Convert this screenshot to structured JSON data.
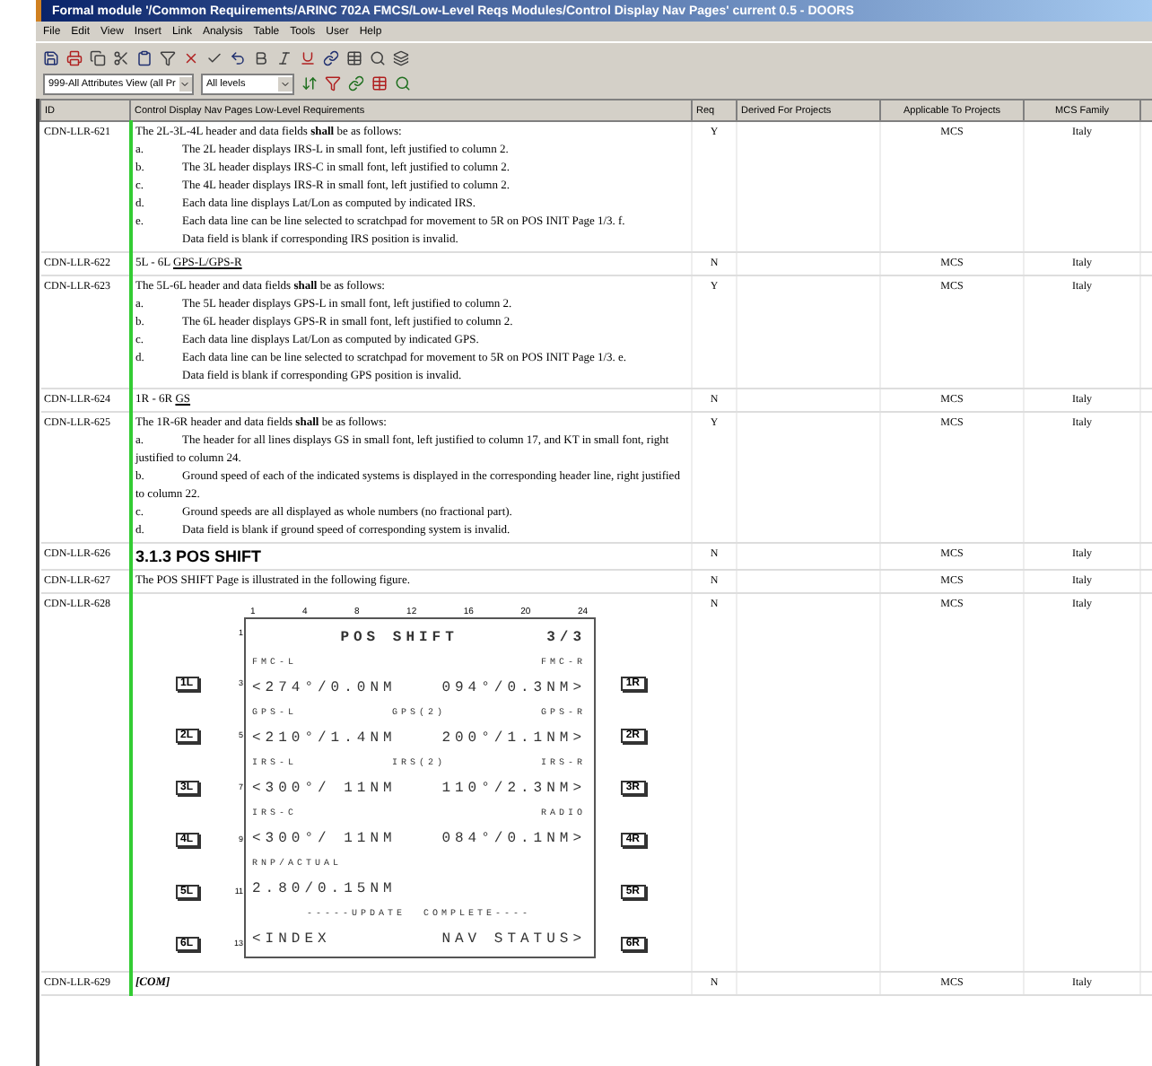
{
  "window": {
    "title": "Formal module '/Common Requirements/ARINC 702A FMCS/Low-Level Reqs Modules/Control Display Nav Pages' current 0.5 - DOORS"
  },
  "menu": [
    "File",
    "Edit",
    "View",
    "Insert",
    "Link",
    "Analysis",
    "Table",
    "Tools",
    "User",
    "Help"
  ],
  "view_bar": {
    "view": "999-All Attributes View (all Pr",
    "levels": "All levels"
  },
  "table": {
    "columns": [
      "ID",
      "Control Display Nav Pages Low-Level Requirements",
      "Req",
      "Derived For Projects",
      "Applicable To Projects",
      "MCS Family"
    ],
    "rows": [
      {
        "id": "CDN-LLR-621",
        "req": "Y",
        "applicable": "MCS",
        "family": "Italy",
        "content": [
          {
            "kind": "para",
            "text": "The 2L-3L-4L header and data fields **shall** be as follows:"
          },
          {
            "kind": "item",
            "marker": "a.",
            "text": "The 2L header displays IRS-L in small font, left justified to column 2."
          },
          {
            "kind": "item",
            "marker": "b.",
            "text": "The 3L header displays IRS-C in small font, left justified to column 2."
          },
          {
            "kind": "item",
            "marker": "c.",
            "text": "The 4L header displays IRS-R in small font, left justified to column 2."
          },
          {
            "kind": "item",
            "marker": "d.",
            "text": "Each data line displays Lat/Lon as computed by indicated IRS."
          },
          {
            "kind": "item",
            "marker": "e.",
            "text": "Each data line can be line selected to scratchpad for movement to 5R on POS INIT Page 1/3. f."
          },
          {
            "kind": "indent",
            "text": "Data field is blank if corresponding IRS position is invalid."
          }
        ]
      },
      {
        "id": "CDN-LLR-622",
        "req": "N",
        "applicable": "MCS",
        "family": "Italy",
        "content": [
          {
            "kind": "link",
            "prefix": "5L - 6L",
            "link": "GPS-L/GPS-R"
          }
        ]
      },
      {
        "id": "CDN-LLR-623",
        "req": "Y",
        "applicable": "MCS",
        "family": "Italy",
        "content": [
          {
            "kind": "para",
            "text": "The 5L-6L header and data fields **shall** be as follows:"
          },
          {
            "kind": "item",
            "marker": "a.",
            "text": "The 5L header displays GPS-L in small font, left justified to column 2."
          },
          {
            "kind": "item",
            "marker": "b.",
            "text": "The 6L header displays GPS-R in small font, left justified to column 2."
          },
          {
            "kind": "item",
            "marker": "c.",
            "text": "Each data line displays Lat/Lon as computed by indicated GPS."
          },
          {
            "kind": "item",
            "marker": "d.",
            "text": "Each data line can be line selected to scratchpad for movement to 5R on POS INIT Page 1/3. e."
          },
          {
            "kind": "indent",
            "text": "Data field is blank if corresponding GPS position is invalid."
          }
        ]
      },
      {
        "id": "CDN-LLR-624",
        "req": "N",
        "applicable": "MCS",
        "family": "Italy",
        "content": [
          {
            "kind": "link",
            "prefix": "1R - 6R",
            "link": "GS"
          }
        ]
      },
      {
        "id": "CDN-LLR-625",
        "req": "Y",
        "applicable": "MCS",
        "family": "Italy",
        "content": [
          {
            "kind": "para",
            "text": "The 1R-6R header and data fields **shall** be as follows:"
          },
          {
            "kind": "item",
            "marker": "a.",
            "text": "The header for all lines displays GS in small font, left justified to column 17, and KT in small font, right justified to column 24."
          },
          {
            "kind": "item",
            "marker": "b.",
            "text": "Ground speed of each of the indicated systems is displayed in the corresponding header line, right justified to column 22."
          },
          {
            "kind": "item",
            "marker": "c.",
            "text": "Ground speeds are all displayed as whole numbers (no fractional part)."
          },
          {
            "kind": "item",
            "marker": "d.",
            "text": "Data field is blank if ground speed of corresponding system is invalid."
          }
        ]
      },
      {
        "id": "CDN-LLR-626",
        "req": "N",
        "applicable": "MCS",
        "family": "Italy",
        "content": [
          {
            "kind": "heading",
            "text": "3.1.3 POS SHIFT"
          }
        ]
      },
      {
        "id": "CDN-LLR-627",
        "req": "N",
        "applicable": "MCS",
        "family": "Italy",
        "content": [
          {
            "kind": "para",
            "text": "The POS SHIFT Page is illustrated in the following figure."
          }
        ]
      },
      {
        "id": "CDN-LLR-628",
        "req": "N",
        "applicable": "MCS",
        "family": "Italy",
        "content": [
          {
            "kind": "figure",
            "columns": [
              "1",
              "4",
              "8",
              "12",
              "16",
              "20",
              "24"
            ],
            "lines": [
              {
                "kind": "title",
                "num": "1",
                "center": "POS SHIFT",
                "right": "3/3"
              },
              {
                "kind": "small",
                "left": "FMC-L",
                "right": "FMC-R"
              },
              {
                "kind": "large",
                "num": "3",
                "key_left": "1L",
                "key_right": "1R",
                "left": "<274°/0.0NM",
                "right": "094°/0.3NM>"
              },
              {
                "kind": "small",
                "left": "GPS-L",
                "center": "GPS(2)",
                "right": "GPS-R"
              },
              {
                "kind": "large",
                "num": "5",
                "key_left": "2L",
                "key_right": "2R",
                "left": "<210°/1.4NM",
                "right": "200°/1.1NM>"
              },
              {
                "kind": "small",
                "left": "IRS-L",
                "center": "IRS(2)",
                "right": "IRS-R"
              },
              {
                "kind": "large",
                "num": "7",
                "key_left": "3L",
                "key_right": "3R",
                "left": "<300°/ 11NM",
                "right": "110°/2.3NM>"
              },
              {
                "kind": "small",
                "left": "IRS-C",
                "right": "RADIO"
              },
              {
                "kind": "large",
                "num": "9",
                "key_left": "4L",
                "key_right": "4R",
                "left": "<300°/ 11NM",
                "right": "084°/0.1NM>"
              },
              {
                "kind": "small",
                "left": "RNP/ACTUAL"
              },
              {
                "kind": "large",
                "num": "11",
                "key_left": "5L",
                "key_right": "5R",
                "left": "2.80/0.15NM"
              },
              {
                "kind": "small",
                "center": "-----UPDATE  COMPLETE----"
              },
              {
                "kind": "large",
                "num": "13",
                "key_left": "6L",
                "key_right": "6R",
                "left": "<INDEX",
                "right": "NAV STATUS>"
              }
            ]
          }
        ]
      },
      {
        "id": "CDN-LLR-629",
        "req": "N",
        "applicable": "MCS",
        "family": "Italy",
        "content": [
          {
            "kind": "italic",
            "text": "[COM]"
          }
        ]
      }
    ]
  }
}
